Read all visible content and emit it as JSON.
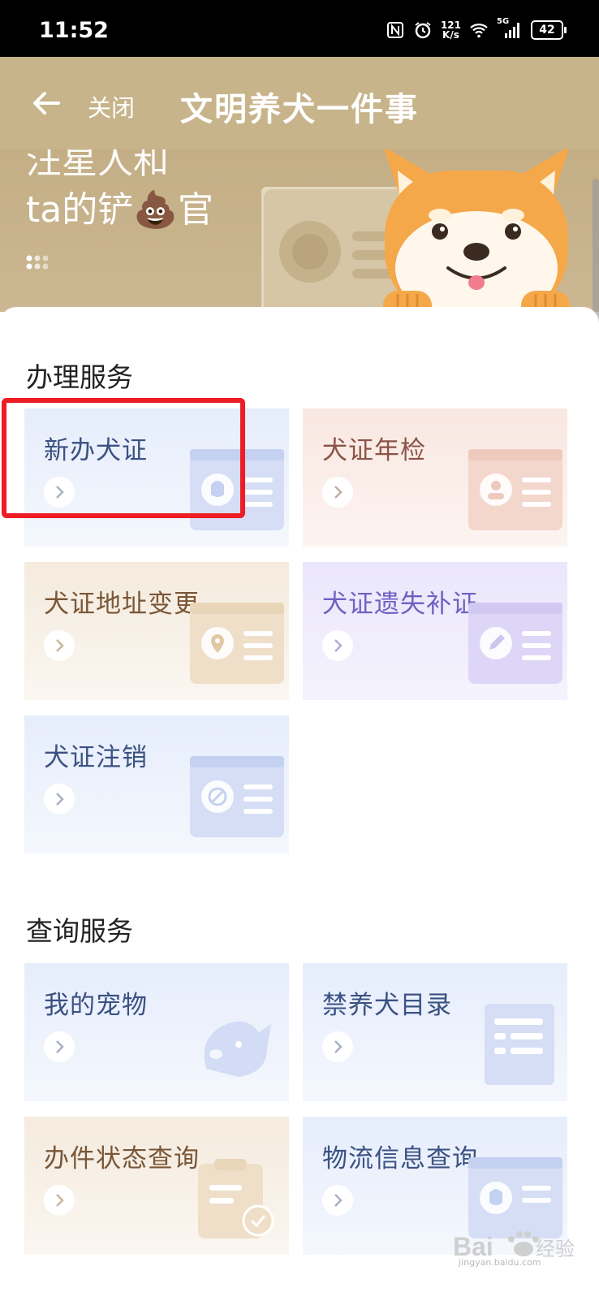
{
  "status_bar": {
    "time": "11:52",
    "speed_value": "121",
    "speed_unit": "K/s",
    "network": "5G",
    "battery": "42",
    "icons": [
      "nfc-icon",
      "alarm-icon",
      "wifi-icon",
      "signal-icon",
      "battery-icon"
    ]
  },
  "nav": {
    "back_icon": "arrow-left-icon",
    "close_label": "关闭",
    "title": "文明养犬一件事"
  },
  "banner": {
    "line1": "汪星人和",
    "line2": "ta的铲💩官"
  },
  "sections": [
    {
      "title": "办理服务",
      "cards": [
        {
          "label": "新办犬证",
          "theme": "blue",
          "icon": "dog-license-icon"
        },
        {
          "label": "犬证年检",
          "theme": "pink",
          "icon": "id-card-person-icon"
        },
        {
          "label": "犬证地址变更",
          "theme": "tan",
          "icon": "location-pin-icon"
        },
        {
          "label": "犬证遗失补证",
          "theme": "purple",
          "icon": "pencil-edit-icon"
        },
        {
          "label": "犬证注销",
          "theme": "blue",
          "icon": "cancel-icon"
        }
      ]
    },
    {
      "title": "查询服务",
      "cards": [
        {
          "label": "我的宠物",
          "theme": "blue",
          "icon": "dog-head-icon"
        },
        {
          "label": "禁养犬目录",
          "theme": "blue",
          "icon": "list-document-icon"
        },
        {
          "label": "办件状态查询",
          "theme": "tan",
          "icon": "clipboard-check-icon"
        },
        {
          "label": "物流信息查询",
          "theme": "blue",
          "icon": "dog-license-icon"
        }
      ]
    }
  ],
  "watermark": {
    "brand": "Baidu经验",
    "url": "jingyan.baidu.com"
  },
  "colors": {
    "nav_bg": "#c8b48b",
    "highlight": "#ee1c24",
    "blue_text": "#3a5182",
    "pink_text": "#8a5446",
    "tan_text": "#7a5636",
    "purple_text": "#6e61c2"
  }
}
